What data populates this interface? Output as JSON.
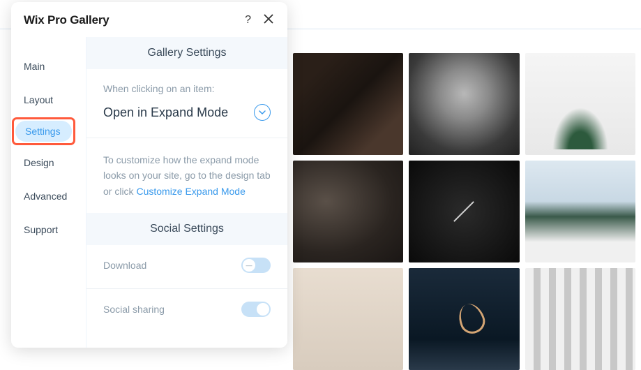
{
  "panel": {
    "title": "Wix Pro Gallery"
  },
  "sidebar": {
    "items": [
      {
        "label": "Main"
      },
      {
        "label": "Layout"
      },
      {
        "label": "Settings"
      },
      {
        "label": "Design"
      },
      {
        "label": "Advanced"
      },
      {
        "label": "Support"
      }
    ]
  },
  "gallerySettings": {
    "heading": "Gallery Settings",
    "clickLabel": "When clicking on an item:",
    "clickValue": "Open in Expand Mode",
    "hintPrefix": "To customize how the expand mode looks on your site, go to the design tab or click ",
    "hintLink": "Customize Expand Mode"
  },
  "socialSettings": {
    "heading": "Social Settings",
    "download": {
      "label": "Download",
      "on": false
    },
    "sharing": {
      "label": "Social sharing",
      "on": true
    }
  }
}
